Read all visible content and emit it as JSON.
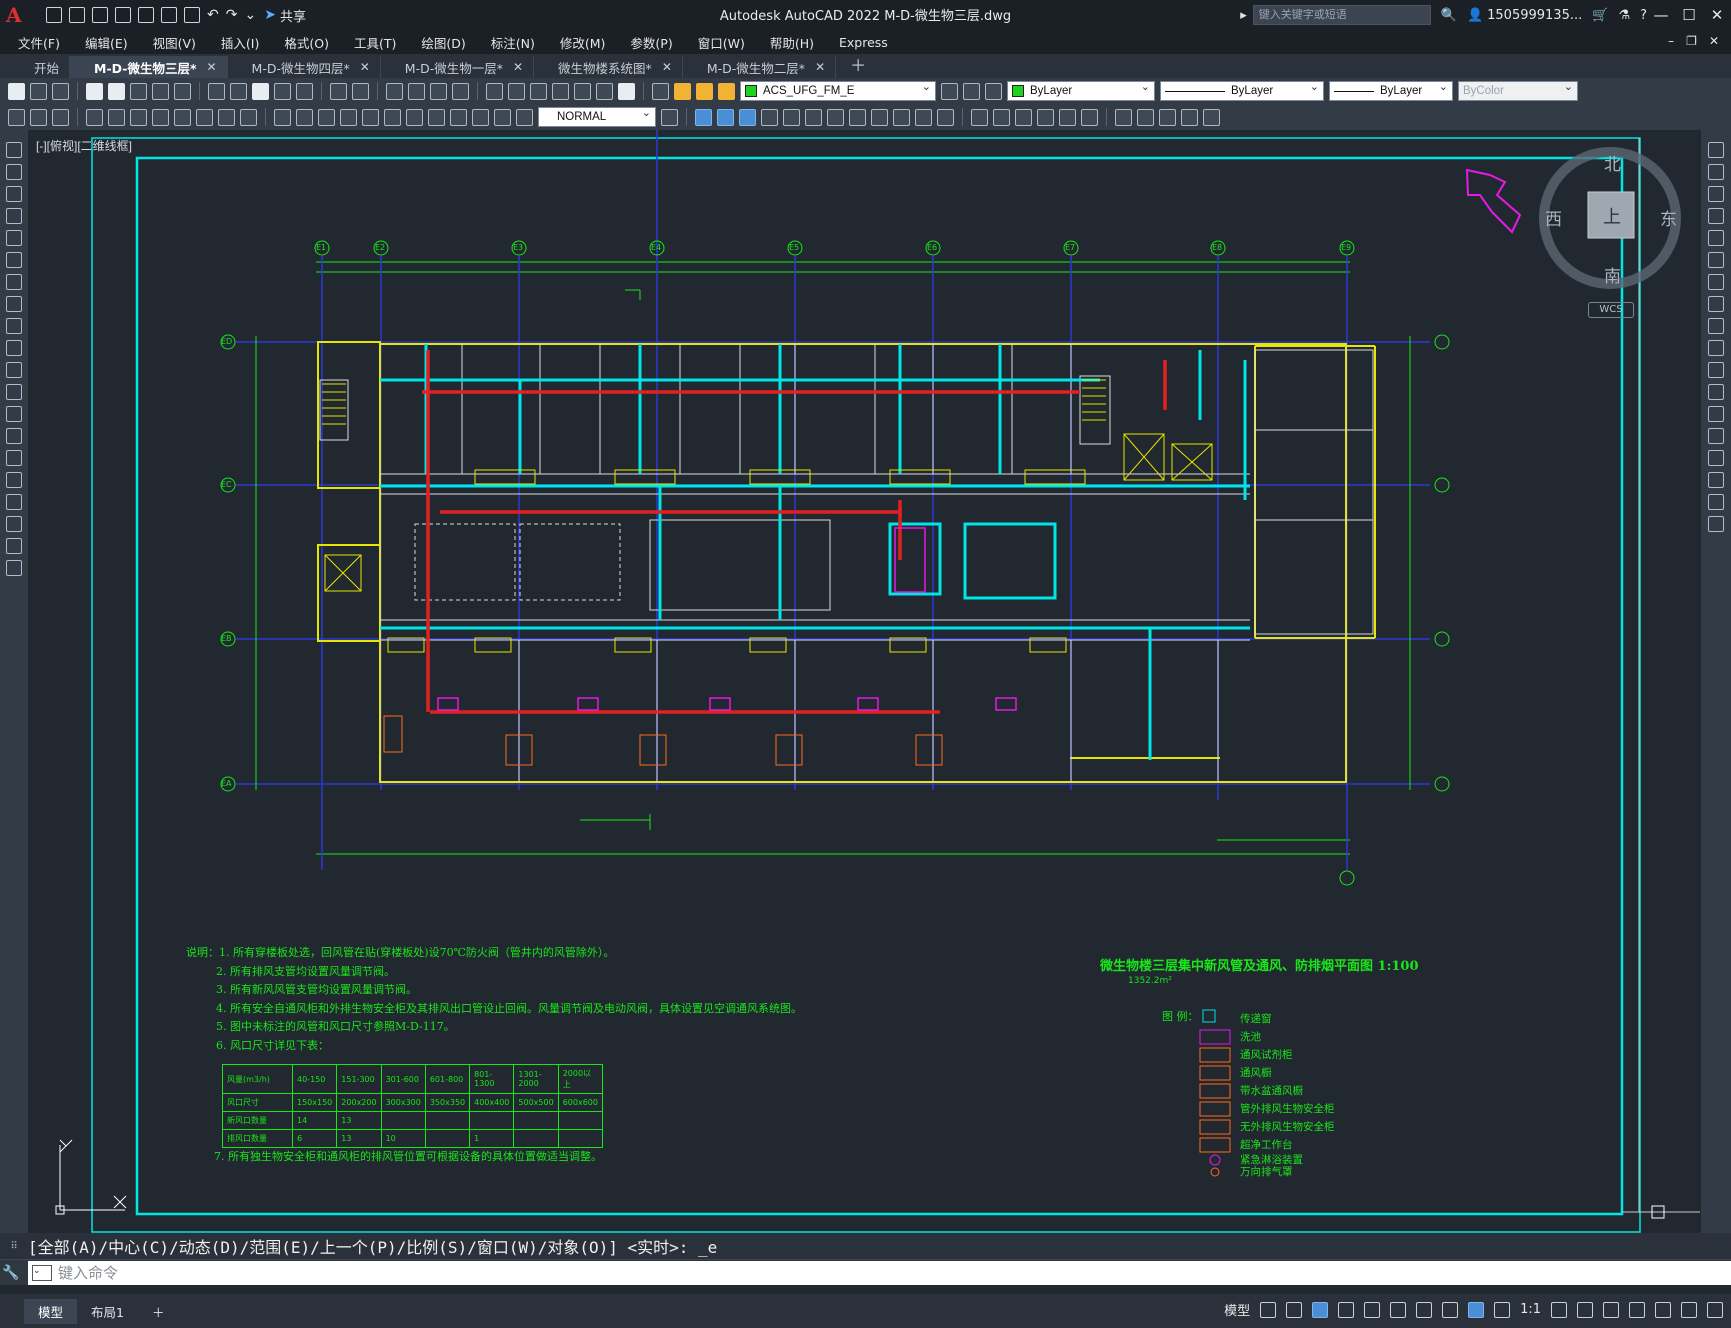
{
  "window": {
    "title": "Autodesk AutoCAD 2022    M-D-微生物三层.dwg",
    "share_label": "共享",
    "search_placeholder": "键入关键字或短语",
    "user": "1505999135..."
  },
  "menu": [
    "文件(F)",
    "编辑(E)",
    "视图(V)",
    "插入(I)",
    "格式(O)",
    "工具(T)",
    "绘图(D)",
    "标注(N)",
    "修改(M)",
    "参数(P)",
    "窗口(W)",
    "帮助(H)",
    "Express"
  ],
  "tabs": [
    {
      "label": "开始",
      "closable": false,
      "active": false
    },
    {
      "label": "M-D-微生物三层*",
      "closable": true,
      "active": true
    },
    {
      "label": "M-D-微生物四层*",
      "closable": true,
      "active": false
    },
    {
      "label": "M-D-微生物一层*",
      "closable": true,
      "active": false
    },
    {
      "label": "微生物楼系统图*",
      "closable": true,
      "active": false
    },
    {
      "label": "M-D-微生物二层*",
      "closable": true,
      "active": false
    }
  ],
  "toolbar": {
    "layer": "ACS_UFG_FM_E",
    "color": "ByLayer",
    "linetype": "ByLayer",
    "lineweight": "ByLayer",
    "plotstyle": "ByColor",
    "dimstyle": "NORMAL"
  },
  "viewport_label": "[-][俯视][二维线框]",
  "viewcube": {
    "north": "北",
    "south": "南",
    "east": "东",
    "west": "西",
    "face": "上",
    "wcs": "WCS"
  },
  "drawing": {
    "grid_top": [
      "E1",
      "E2",
      "E3",
      "E4",
      "E5",
      "E6",
      "E7",
      "E8",
      "E9"
    ],
    "grid_side": [
      "ED",
      "EC",
      "EB",
      "EA"
    ],
    "title": "微生物楼三层集中新风管及通风、防排烟平面图  1:100",
    "area": "1352.2m²",
    "notes_heading": "说明：",
    "notes": [
      "1. 所有穿楼板处选，回风管在贴(穿楼板处)设70℃防火阀（管井内的风管除外）。",
      "2. 所有排风支管均设置风量调节阀。",
      "3. 所有新风风管支管均设置风量调节阀。",
      "4. 所有安全自通风柜和外排生物安全柜及其排风出口管设止回阀。风量调节阀及电动风阀，具体设置见空调通风系统图。",
      "5. 图中未标注的风管和风口尺寸参照M-D-117。",
      "6. 风口尺寸详见下表："
    ],
    "note7": "7. 所有独生物安全柜和通风柜的排风管位置可根据设备的具体位置做适当调整。",
    "airflow_table": {
      "header": [
        "风量(m3/h)",
        "40-150",
        "151-300",
        "301-600",
        "601-800",
        "801-1300",
        "1301-2000",
        "2000以上"
      ],
      "rows": [
        [
          "风口尺寸",
          "150x150",
          "200x200",
          "300x300",
          "350x350",
          "400x400",
          "500x500",
          "600x600"
        ],
        [
          "新风口数量",
          "14",
          "13",
          "",
          "",
          "",
          "",
          ""
        ],
        [
          "排风口数量",
          "6",
          "13",
          "10",
          "",
          "1",
          "",
          ""
        ]
      ]
    },
    "legend_heading": "图 例：",
    "legend": [
      "传递窗",
      "洗池",
      "通风试剂柜",
      "通风橱",
      "带水盆通风橱",
      "管外排风生物安全柜",
      "无外排风生物安全柜",
      "超净工作台",
      "紧急淋浴装置",
      "万向排气罩"
    ]
  },
  "command": {
    "history": "[全部(A)/中心(C)/动态(D)/范围(E)/上一个(P)/比例(S)/窗口(W)/对象(O)] <实时>: _e",
    "placeholder": "键入命令"
  },
  "status": {
    "layouts": [
      "模型",
      "布局1"
    ],
    "model_label": "模型",
    "scale": "1:1"
  },
  "colors": {
    "frame_cyan": "#00e5e5",
    "wall_yellow": "#e6e600",
    "duct_red": "#e32020",
    "annot_green": "#19e619",
    "grid_blue": "#2b38d6",
    "accent_magenta": "#e619e6"
  }
}
